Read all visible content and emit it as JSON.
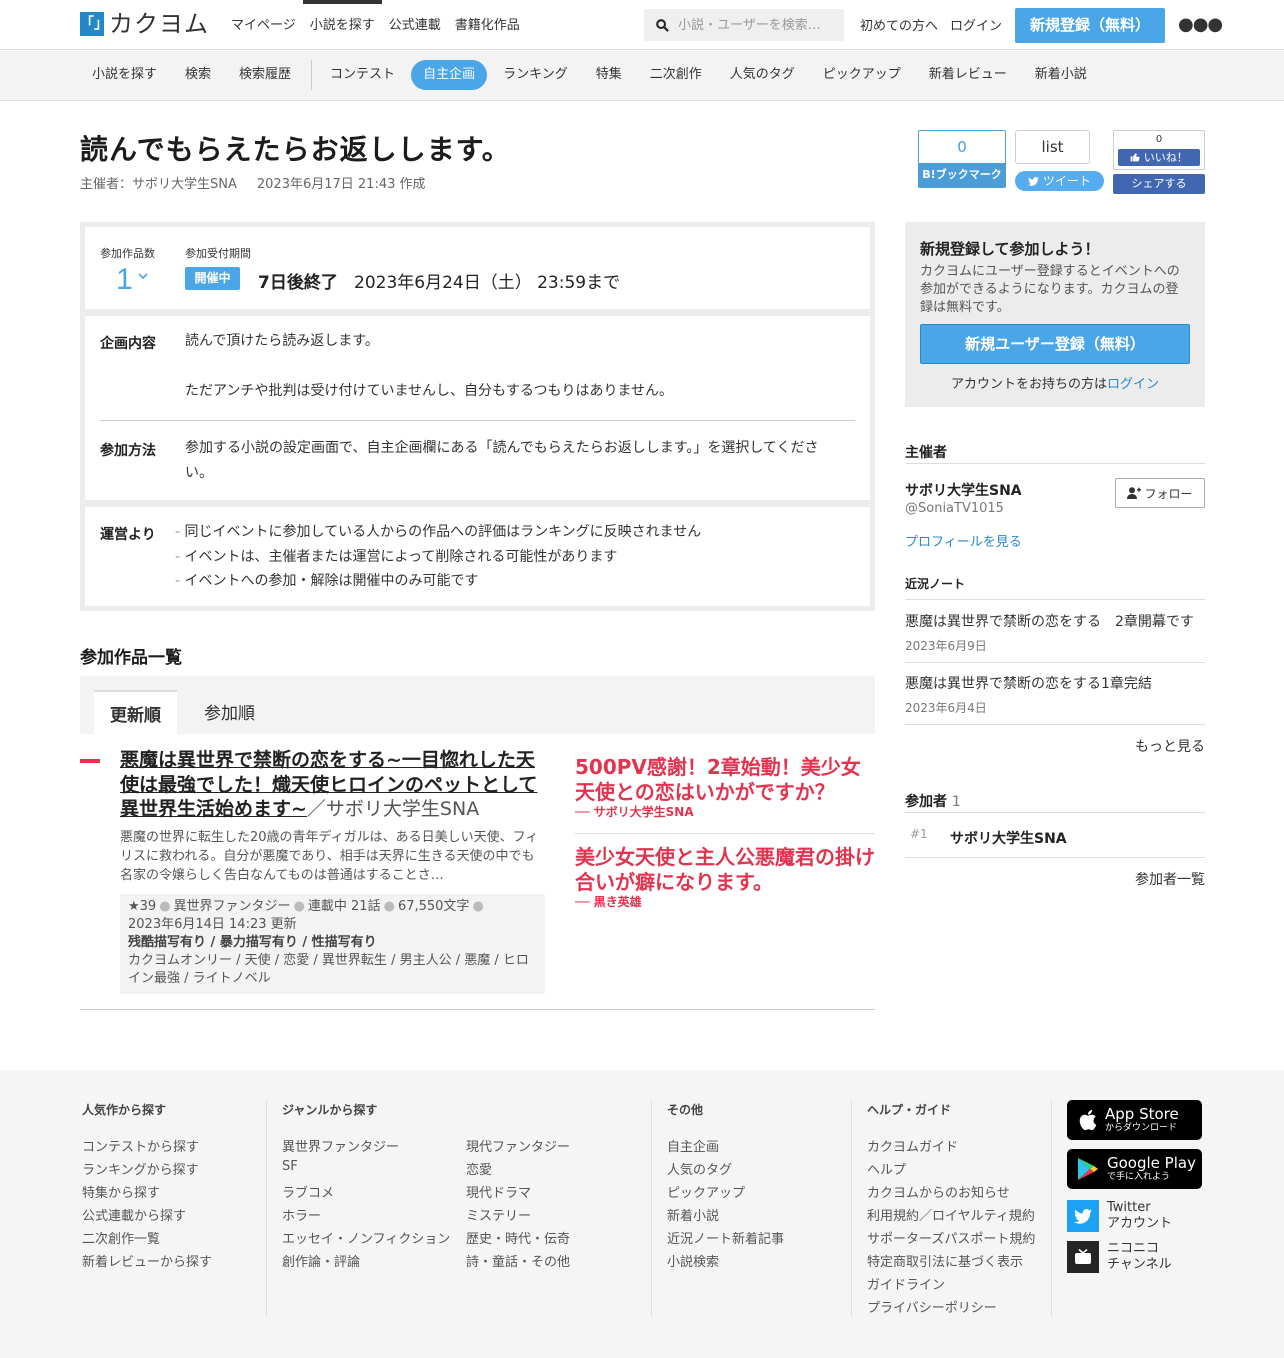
{
  "header": {
    "logo_mark": "「」",
    "logo_text": "カクヨム",
    "nav": [
      {
        "label": "マイページ"
      },
      {
        "label": "小説を探す"
      },
      {
        "label": "公式連載"
      },
      {
        "label": "書籍化作品"
      }
    ],
    "search_placeholder": "小説・ユーザーを検索…",
    "beginners": "初めての方へ",
    "login": "ログイン",
    "signup": "新規登録（無料）"
  },
  "subnav": [
    {
      "label": "小説を探す"
    },
    {
      "label": "検索"
    },
    {
      "label": "検索履歴"
    },
    {
      "label": "コンテスト"
    },
    {
      "label": "自主企画"
    },
    {
      "label": "ランキング"
    },
    {
      "label": "特集"
    },
    {
      "label": "二次創作"
    },
    {
      "label": "人気のタグ"
    },
    {
      "label": "ピックアップ"
    },
    {
      "label": "新着レビュー"
    },
    {
      "label": "新着小説"
    }
  ],
  "event": {
    "title": "読んでもらえたらお返しします。",
    "host_line": "主催者：サボリ大学生SNA",
    "created": "2023年6月17日 21:43 作成",
    "entries_label": "参加作品数",
    "entries_count": "1",
    "period_label": "参加受付期間",
    "status": "開催中",
    "remaining": "7日後終了",
    "deadline": "2023年6月24日（土） 23:59まで",
    "content_label": "企画内容",
    "content_1": "読んで頂けたら読み返します。",
    "content_2": "ただアンチや批判は受け付けていませんし、自分もするつもりはありません。",
    "method_label": "参加方法",
    "method_text": "参加する小説の設定画面で、自主企画欄にある「読んでもらえたらお返しします。」を選択してください。",
    "admin_label": "運営より",
    "admin_notes": [
      "同じイベントに参加している人からの作品への評価はランキングに反映されません",
      "イベントは、主催者または運営によって削除される可能性があります",
      "イベントへの参加・解除は開催中のみ可能です"
    ]
  },
  "share": {
    "hatebu_count": "0",
    "hatebu_label": "B!ブックマーク",
    "tweet_count": "list",
    "tweet_label": "ツイート",
    "fb_count": "0",
    "fb_like": "いいね！",
    "fb_share": "シェアする"
  },
  "works": {
    "section_title": "参加作品一覧",
    "tabs": [
      "更新順",
      "参加順"
    ],
    "item": {
      "title": "悪魔は異世界で禁断の恋をする~一目惚れした天使は最強でした！熾天使ヒロインのペットとして異世界生活始めます~",
      "author": "／サボリ大学生SNA",
      "intro": "悪魔の世界に転生した20歳の青年ディガルは、ある日美しい天使、フィリスに救われる。自分が悪魔であり、相手は天界に生きる天使の中でも名家の令嬢らしく告白なんてものは普通はすることさ…",
      "stars": "★39",
      "genre": "異世界ファンタジー",
      "status": "連載中 21話",
      "chars": "67,550文字",
      "updated": "2023年6月14日 14:23 更新",
      "warnings": [
        "残酷描写有り",
        "暴力描写有り",
        "性描写有り"
      ],
      "tags": "カクヨムオンリー / 天使 / 恋愛 / 異世界転生 / 男主人公 / 悪魔 / ヒロイン最強 / ライトノベル"
    },
    "catches": [
      {
        "text": "500PV感謝！2章始動！美少女天使との恋はいかがですか？",
        "by": "── サボリ大学生SNA"
      },
      {
        "text": "美少女天使と主人公悪魔君の掛け合いが癖になります。",
        "by": "── 黒き英雄"
      }
    ]
  },
  "sidebar": {
    "reg_title": "新規登録して参加しよう！",
    "reg_desc": "カクヨムにユーザー登録するとイベントへの参加ができるようになります。カクヨムの登録は無料です。",
    "reg_button": "新規ユーザー登録（無料）",
    "reg_login_prefix": "アカウントをお持ちの方は",
    "reg_login_link": "ログイン",
    "host_heading": "主催者",
    "host_name": "サボリ大学生SNA",
    "host_id": "@SoniaTV1015",
    "follow": "フォロー",
    "profile_link": "プロフィールを見る",
    "notes_heading": "近況ノート",
    "notes": [
      {
        "title": "悪魔は異世界で禁断の恋をする　2章開幕です",
        "date": "2023年6月9日"
      },
      {
        "title": "悪魔は異世界で禁断の恋をする1章完結",
        "date": "2023年6月4日"
      }
    ],
    "notes_more": "もっと見る",
    "participants_heading": "参加者",
    "participants_count": "1",
    "participants": [
      {
        "rank": "#1",
        "name": "サボリ大学生SNA"
      }
    ],
    "participants_more": "参加者一覧"
  },
  "footer": {
    "popular": {
      "heading": "人気作から探す",
      "links": [
        "コンテストから探す",
        "ランキングから探す",
        "特集から探す",
        "公式連載から探す",
        "二次創作一覧",
        "新着レビューから探す"
      ]
    },
    "genre": {
      "heading": "ジャンルから探す",
      "col1": [
        "異世界ファンタジー",
        "SF",
        "ラブコメ",
        "ホラー",
        "エッセイ・ノンフィクション",
        "創作論・評論"
      ],
      "col2": [
        "現代ファンタジー",
        "恋愛",
        "現代ドラマ",
        "ミステリー",
        "歴史・時代・伝奇",
        "詩・童話・その他"
      ]
    },
    "other": {
      "heading": "その他",
      "links": [
        "自主企画",
        "人気のタグ",
        "ピックアップ",
        "新着小説",
        "近況ノート新着記事",
        "小説検索"
      ]
    },
    "help": {
      "heading": "ヘルプ・ガイド",
      "links": [
        "カクヨムガイド",
        "ヘルプ",
        "カクヨムからのお知らせ",
        "利用規約／ロイヤルティ規約",
        "サポーターズパスポート規約",
        "特定商取引法に基づく表示",
        "ガイドライン",
        "プライバシーポリシー"
      ]
    },
    "appstore": {
      "big": "App Store",
      "small": "からダウンロード"
    },
    "googleplay": {
      "big": "Google Play",
      "small": "で手に入れよう"
    },
    "twitter": {
      "line1": "Twitter",
      "line2": "アカウント"
    },
    "niconico": {
      "line1": "ニコニコ",
      "line2": "チャンネル"
    }
  }
}
